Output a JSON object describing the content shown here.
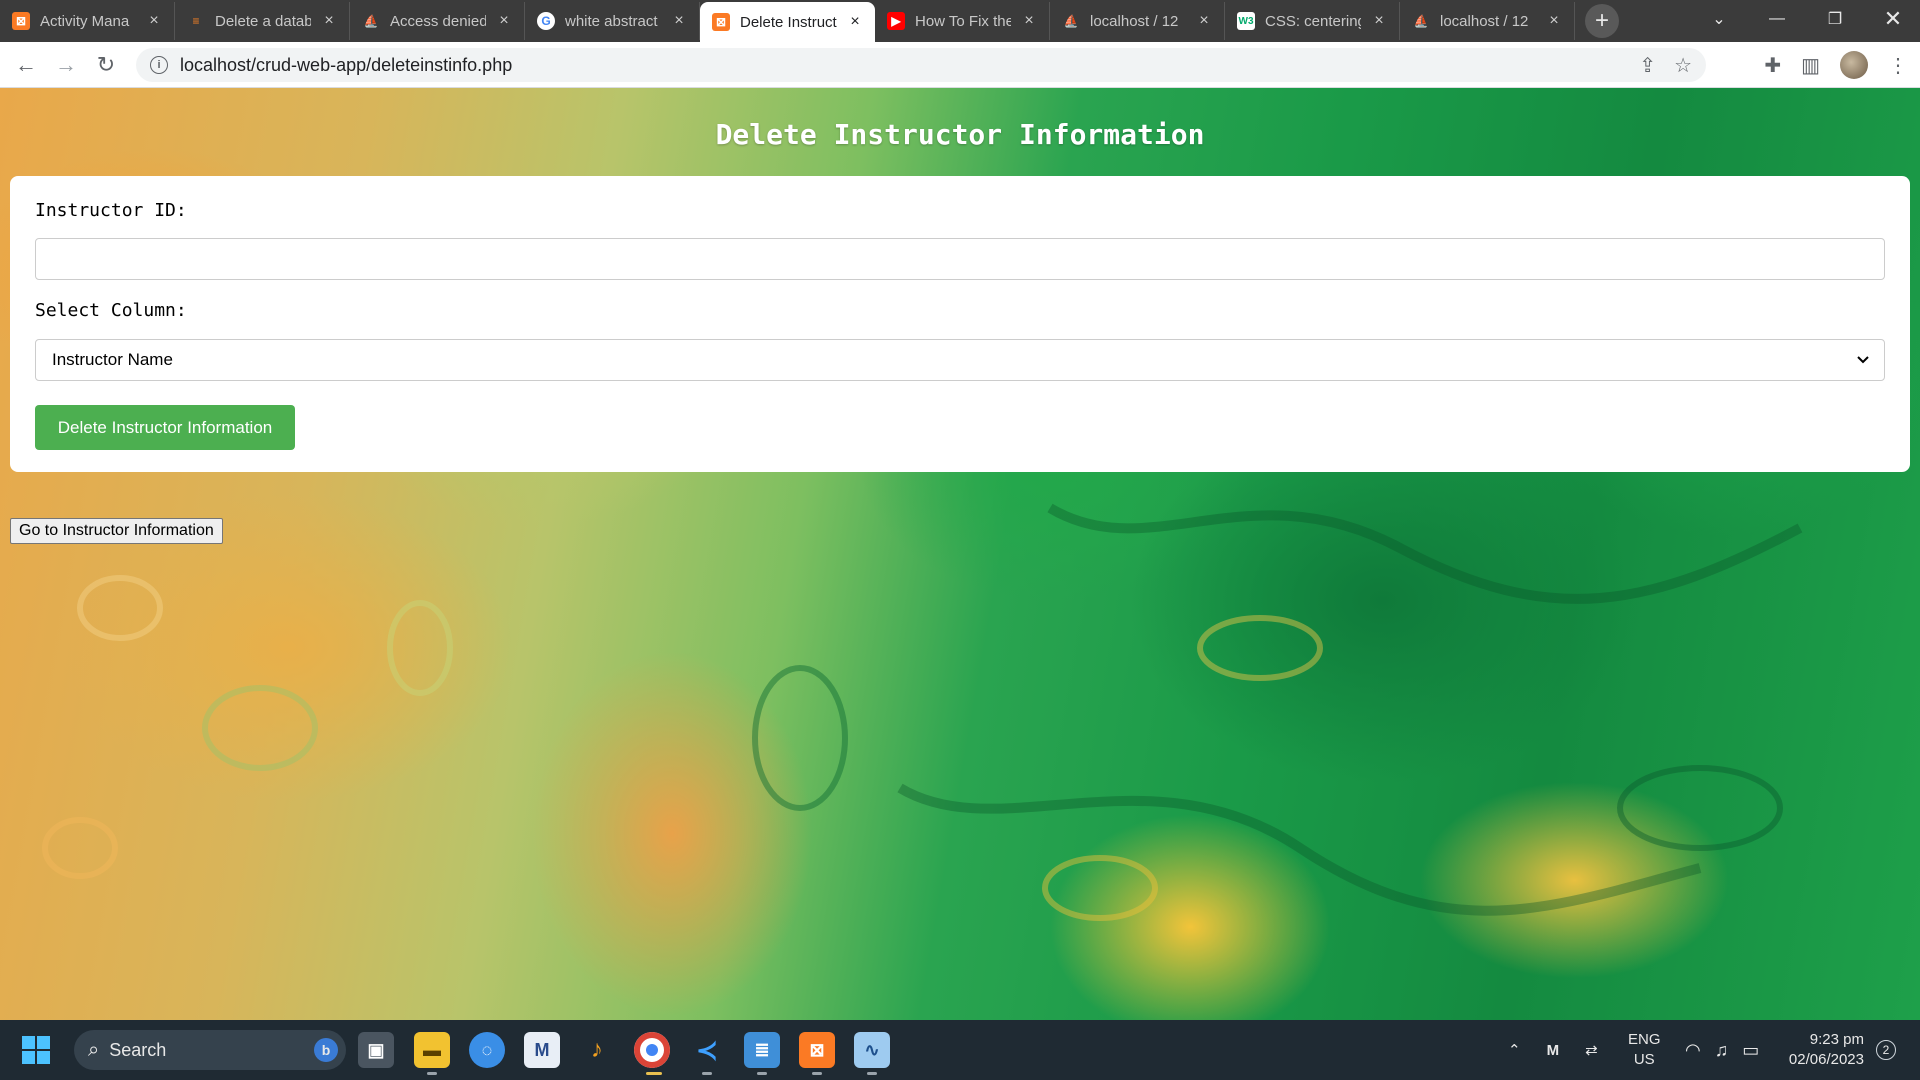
{
  "browser": {
    "tabs": [
      {
        "title": "Activity Mana",
        "favicon": "xampp-icon",
        "active": false
      },
      {
        "title": "Delete a datab",
        "favicon": "stackoverflow-icon",
        "active": false
      },
      {
        "title": "Access denied",
        "favicon": "phpmyadmin-icon",
        "active": false
      },
      {
        "title": "white abstract",
        "favicon": "google-icon",
        "active": false
      },
      {
        "title": "Delete Instruct",
        "favicon": "xampp-icon",
        "active": true
      },
      {
        "title": "How To Fix the",
        "favicon": "youtube-icon",
        "active": false
      },
      {
        "title": "localhost / 12",
        "favicon": "phpmyadmin-icon",
        "active": false
      },
      {
        "title": "CSS: centering",
        "favicon": "w3schools-icon",
        "active": false
      },
      {
        "title": "localhost / 12",
        "favicon": "phpmyadmin-icon",
        "active": false
      }
    ],
    "url": "localhost/crud-web-app/deleteinstinfo.php"
  },
  "page": {
    "title": "Delete Instructor Information",
    "form": {
      "instructor_id_label": "Instructor ID:",
      "instructor_id_value": "",
      "select_column_label": "Select Column:",
      "select_column_value": "Instructor Name",
      "submit_label": "Delete Instructor Information"
    },
    "go_button_label": "Go to Instructor Information"
  },
  "taskbar": {
    "search_label": "Search",
    "language_primary": "ENG",
    "language_secondary": "US",
    "time": "9:23 pm",
    "date": "02/06/2023",
    "notification_count": "2"
  },
  "colors": {
    "accent_green": "#4caf50",
    "tabstrip": "#3b3b3b",
    "taskbar": "#1f2a33"
  }
}
